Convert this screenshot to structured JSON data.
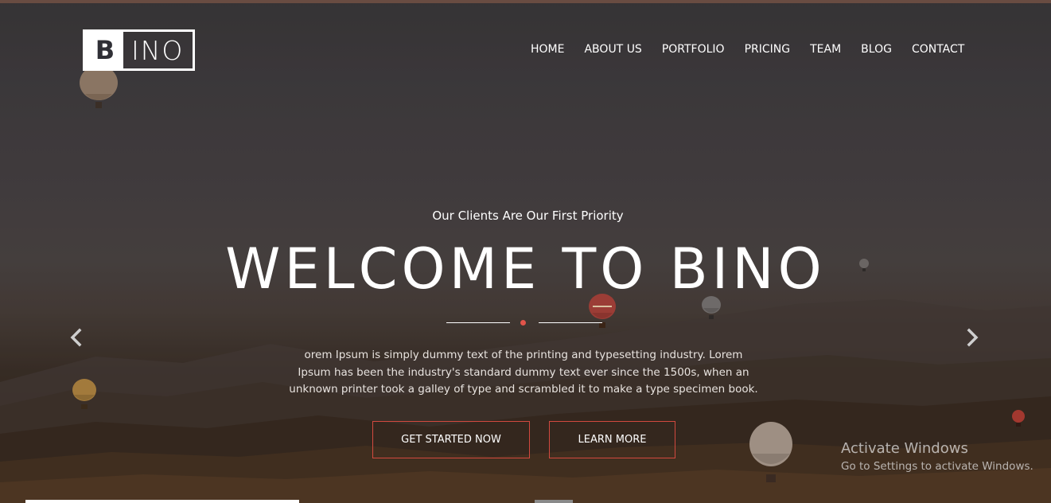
{
  "logo": {
    "letter": "B",
    "rest": "INO"
  },
  "nav": {
    "items": [
      {
        "label": "HOME"
      },
      {
        "label": "ABOUT US"
      },
      {
        "label": "PORTFOLIO"
      },
      {
        "label": "PRICING"
      },
      {
        "label": "TEAM"
      },
      {
        "label": "BLOG"
      },
      {
        "label": "CONTACT"
      }
    ]
  },
  "hero": {
    "subtitle": "Our Clients Are Our First Priority",
    "title": "WELCOME TO BINO",
    "description": "orem Ipsum is simply dummy text of the printing and typesetting industry. Lorem Ipsum has been the industry's standard dummy text ever since the 1500s, when an unknown printer took a galley of type and scrambled it to make a type specimen book.",
    "primary_button": "GET STARTED NOW",
    "secondary_button": "LEARN MORE",
    "accent_color": "#e2544a"
  },
  "carousel": {
    "prev_icon": "chevron-left-icon",
    "next_icon": "chevron-right-icon"
  },
  "watermark": {
    "line1": "Activate Windows",
    "line2": "Go to Settings to activate Windows."
  }
}
